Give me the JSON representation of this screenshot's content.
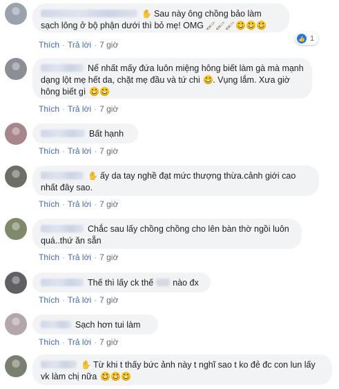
{
  "actions": {
    "like": "Thích",
    "reply": "Trả lời",
    "sep": "·"
  },
  "comments": [
    {
      "text": "Sau này ông chồng bảo làm sạch lông ở bộ phận dưới thì bỏ mẹ! OMG",
      "time": "7 giờ",
      "reactions": "1",
      "avatar_color": "#9aa3ad"
    },
    {
      "text": "Nể nhất mấy đứa luôn miệng hông biết làm gà mà mạnh dạng lột mẹ hết da, chặt mẹ đầu và tứ chi",
      "text2": ". Vụng lắm. Xưa giờ hông biết gì",
      "time": "7 giờ",
      "avatar_color": "#8b8f95"
    },
    {
      "text": "Bất hạnh",
      "time": "7 giờ",
      "avatar_color": "#a7858a"
    },
    {
      "text": "ấy da tay nghề đạt mức thượng thừa.cảnh giới cao nhất đây sao.",
      "time": "7 giờ",
      "avatar_color": "#6b6f66"
    },
    {
      "text": "Chắc sau lấy chồng chồng cho lên bàn thờ ngồi luôn quá..thứ ăn sẵn",
      "time": "7 giờ",
      "avatar_color": "#7e8a6a"
    },
    {
      "text_a": "Thế thì lấy ck thế",
      "text_b": "nào đx",
      "time": "7 giờ",
      "avatar_color": "#5f6066"
    },
    {
      "text": "Sạch hơn tui làm",
      "time": "7 giờ",
      "avatar_color": "#b3a7a9"
    },
    {
      "text": "Từ khi t thấy bức ảnh này t nghĩ sao t ko đẻ đc con lun lấy vk làm chị nữa",
      "time": "7 giờ",
      "avatar_color": "#7a8070"
    }
  ]
}
